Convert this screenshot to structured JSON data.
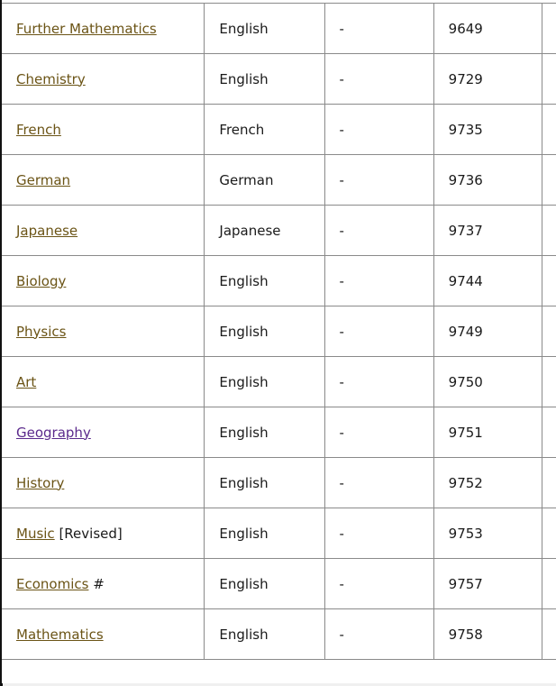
{
  "colors": {
    "link": "#6b5416",
    "visited_link": "#5b2a8c",
    "border": "#8a8a8a"
  },
  "rows": [
    {
      "subject": "Further Mathematics",
      "suffix": "",
      "language": "English",
      "extra": "-",
      "code": "9649",
      "visited": false
    },
    {
      "subject": "Chemistry",
      "suffix": "",
      "language": "English",
      "extra": "-",
      "code": "9729",
      "visited": false
    },
    {
      "subject": "French",
      "suffix": "",
      "language": "French",
      "extra": "-",
      "code": "9735",
      "visited": false
    },
    {
      "subject": "German",
      "suffix": "",
      "language": "German",
      "extra": "-",
      "code": "9736",
      "visited": false
    },
    {
      "subject": "Japanese",
      "suffix": "",
      "language": "Japanese",
      "extra": "-",
      "code": "9737",
      "visited": false
    },
    {
      "subject": "Biology",
      "suffix": "",
      "language": "English",
      "extra": "-",
      "code": "9744",
      "visited": false
    },
    {
      "subject": "Physics",
      "suffix": "",
      "language": "English",
      "extra": "-",
      "code": "9749",
      "visited": false
    },
    {
      "subject": "Art",
      "suffix": "",
      "language": "English",
      "extra": "-",
      "code": "9750",
      "visited": false
    },
    {
      "subject": "Geography",
      "suffix": "",
      "language": "English",
      "extra": "-",
      "code": "9751",
      "visited": true
    },
    {
      "subject": "History",
      "suffix": "",
      "language": "English",
      "extra": "-",
      "code": "9752",
      "visited": false
    },
    {
      "subject": "Music",
      "suffix": " [Revised]",
      "language": "English",
      "extra": "-",
      "code": "9753",
      "visited": false
    },
    {
      "subject": "Economics",
      "suffix": " #",
      "language": "English",
      "extra": "-",
      "code": "9757",
      "visited": false
    },
    {
      "subject": "Mathematics",
      "suffix": "",
      "language": "English",
      "extra": "-",
      "code": "9758",
      "visited": false
    }
  ]
}
